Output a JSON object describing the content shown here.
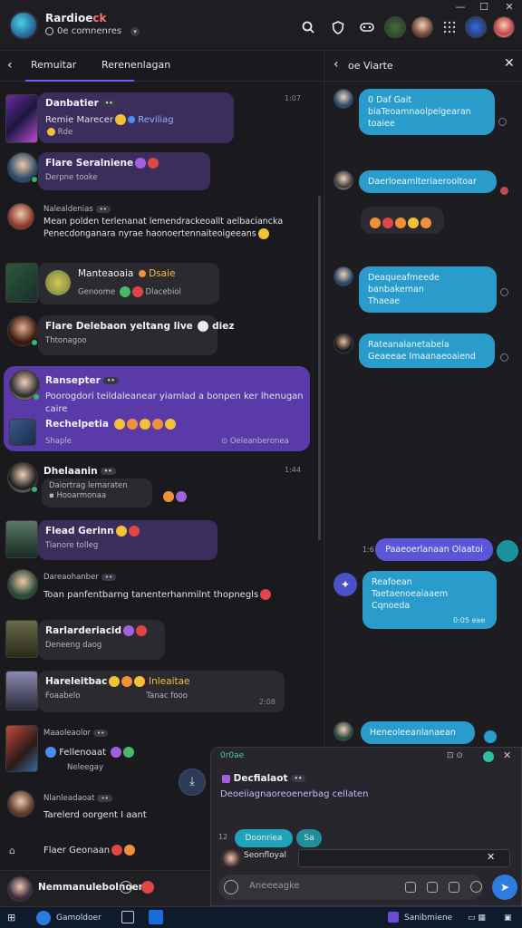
{
  "window": {
    "app_name": "Rardioe",
    "app_name_accent": "ck",
    "subtitle": "0e comnenres",
    "icons": [
      "search-icon",
      "shield-icon",
      "controller-icon",
      "grid-icon"
    ],
    "controls": [
      "—",
      "☐",
      "✕"
    ]
  },
  "left": {
    "tabs": [
      "Remuitar",
      "Rerenenlagan"
    ],
    "messages": [
      {
        "name": "Danbatier",
        "line1": "Remie Marecer",
        "line2": "Reviliag",
        "line3": "Rde",
        "time": "1:07"
      },
      {
        "name": "Flare Seralniene",
        "line1": "Derpne tooke"
      },
      {
        "name": "Nalealdenias",
        "line1": "Mean polden terlenanat lemendrackeoallt aelbaciancka",
        "line2": "Penecdonganara nyrae haonoertennaiteoigeeans"
      },
      {
        "name": "Manteaoaia",
        "extra": "Dsaie",
        "line1": "Genoome",
        "line2": "Dlacebiol"
      },
      {
        "name": "Flare Delebaon yeltang live",
        "extra": "diez",
        "line1": "Thtonagoo"
      },
      {
        "name": "Ransepter",
        "line1": "Poorogdori teildaleanear yiamlad a bonpen ker lhenugan",
        "line2": "caire",
        "sub_name": "Rechelpetia",
        "sub_line": "Shaple",
        "footnote": "Oeleanberonea",
        "vivid": true
      },
      {
        "name": "Dhelaanin",
        "line1": "Daiortrag lemaraten",
        "line2": "Hooarmonaa",
        "time": "1:44"
      },
      {
        "name": "Flead Gerinn",
        "line1": "Tianore tolleg"
      },
      {
        "name": "Dareaohanber",
        "line1": "Toan panfentbarng tanenterhanmilnt thopnegls"
      },
      {
        "name": "Rarlarderiacid",
        "line1": "Deneeng daog"
      },
      {
        "name": "Hareleitbac",
        "extra": "Inleaitae",
        "line1": "Foaabelo",
        "line2": "Tanac fooo",
        "time": "2:08"
      },
      {
        "name": "Maaoleaolor",
        "line1": "Fellenoaat",
        "line2": "Neleegay"
      },
      {
        "name": "Nlanleadaoat",
        "line1": "Tarelerd oorgent I aant"
      },
      {
        "name": "Flaer Geonaan"
      }
    ],
    "self": {
      "name": "Nemmanulebolnoen"
    }
  },
  "right": {
    "title": "oe Viarte",
    "messages": [
      {
        "text": "0 Daf Gait\nbiaTeoamnaolpelgearan\ntoaiee",
        "time": ""
      },
      {
        "text": "Daerloeamlteriaerooltoar",
        "time": ""
      },
      {
        "text": "Deaqueafmeede banbakeman\nThaeae",
        "time": ""
      },
      {
        "text": "Rateanalanetabela\nGeaeeae Imaanaeoaiend",
        "time": ""
      },
      {
        "text": "Paaeoerlanaan Olaatoi",
        "time": "1:6"
      },
      {
        "text": "Reafoean\nTaetaenoeaiaaem\nCqnoeda",
        "time": "0:05 eae"
      },
      {
        "text": "Heneoleeanlanaean",
        "time": ""
      }
    ]
  },
  "popup": {
    "label": "0r0ae",
    "title": "Decfialaot",
    "text": "Deoeiiagnaoreoenerbag cellaten",
    "reply_chip": "Doonriea",
    "chip2": "Sa",
    "reply_name": "Seonfloyal",
    "input_placeholder": "Aneeeagke",
    "time": "12"
  },
  "taskbar": {
    "app": "Gamoldoer",
    "right_app": "Sanibmiene"
  }
}
